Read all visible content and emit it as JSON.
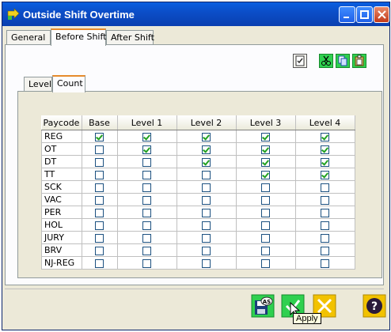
{
  "window": {
    "title": "Outside Shift Overtime"
  },
  "tabs": [
    {
      "label": "General",
      "active": false
    },
    {
      "label": "Before Shift",
      "active": true
    },
    {
      "label": "After Shift",
      "active": false
    }
  ],
  "inner_tabs": [
    {
      "label": "Level",
      "active": false
    },
    {
      "label": "Count",
      "active": true
    }
  ],
  "toolbar": {
    "icons": [
      "select-all-icon",
      "cut-icon",
      "copy-icon",
      "paste-icon"
    ]
  },
  "grid": {
    "columns": [
      "Paycode",
      "Base",
      "Level 1",
      "Level 2",
      "Level 3",
      "Level 4"
    ],
    "rows": [
      {
        "paycode": "REG",
        "checks": [
          true,
          true,
          true,
          true,
          true
        ]
      },
      {
        "paycode": "OT",
        "checks": [
          false,
          true,
          true,
          true,
          true
        ]
      },
      {
        "paycode": "DT",
        "checks": [
          false,
          false,
          true,
          true,
          true
        ]
      },
      {
        "paycode": "TT",
        "checks": [
          false,
          false,
          false,
          true,
          true
        ]
      },
      {
        "paycode": "SCK",
        "checks": [
          false,
          false,
          false,
          false,
          false
        ]
      },
      {
        "paycode": "VAC",
        "checks": [
          false,
          false,
          false,
          false,
          false
        ]
      },
      {
        "paycode": "PER",
        "checks": [
          false,
          false,
          false,
          false,
          false
        ]
      },
      {
        "paycode": "HOL",
        "checks": [
          false,
          false,
          false,
          false,
          false
        ]
      },
      {
        "paycode": "JURY",
        "checks": [
          false,
          false,
          false,
          false,
          false
        ]
      },
      {
        "paycode": "BRV",
        "checks": [
          false,
          false,
          false,
          false,
          false
        ]
      },
      {
        "paycode": "NJ-REG",
        "checks": [
          false,
          false,
          false,
          false,
          false
        ]
      }
    ]
  },
  "bottom": {
    "tooltip": "Apply",
    "save_as_badge": "AS"
  },
  "colors": {
    "titlebar": "#0b4ec8",
    "check": "#21a121",
    "cancel": "#f2c200",
    "active_tab": "#e68b2c"
  }
}
